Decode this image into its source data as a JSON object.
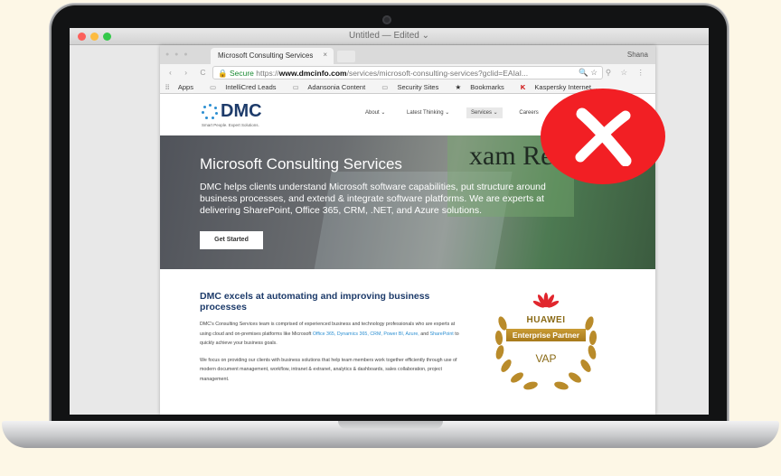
{
  "window": {
    "title": "Untitled — Edited ⌄"
  },
  "browser": {
    "tab_title": "Microsoft Consulting Services",
    "tab_close": "×",
    "profile": "Shana",
    "nav_buttons": "‹ › C",
    "secure_label": "Secure",
    "url_scheme": "https://",
    "url_host": "www.dmcinfo.com",
    "url_path": "/services/microsoft-consulting-services?gclid=EAIaI...",
    "url_tools": "🔍 ☆",
    "ext_icons": "⚲ ☆ ⋮"
  },
  "bookmarks": [
    "Apps",
    "IntelliCred Leads",
    "Adansonia Content",
    "Security Sites",
    "Bookmarks",
    "Kaspersky Internet..."
  ],
  "site": {
    "logo_text": "DMC",
    "logo_tagline": "Smart People. Expert Solutions.",
    "menu": [
      "About ⌄",
      "Latest Thinking ⌄",
      "Services ⌄",
      "Careers"
    ],
    "hero_title": "Microsoft Consulting Services",
    "hero_text": "DMC helps clients understand Microsoft software capabilities, put structure around business processes, and extend & integrate software platforms. We are experts at delivering SharePoint, Office 365, CRM, .NET, and Azure solutions.",
    "hero_book": "xam Ref",
    "cta": "Get Started",
    "section_title": "DMC excels at automating and improving business processes",
    "para1_a": "DMC's Consulting Services team is comprised of experienced business and technology professionals who are experts at using cloud and on-premises platforms like Microsoft ",
    "para1_links": "Office 365, Dynamics 365, CRM, Power BI, Azure,",
    "para1_b": " and ",
    "para1_link2": "SharePoint",
    "para1_c": " to quickly achieve your business goals.",
    "para2": "We focus on providing our clients with business solutions that help team members work together efficiently through use of modern document management, workflow, intranet & extranet, analytics & dashboards, sales collaboration, project management."
  },
  "overlays": {
    "x_badge_icon": "close-x-icon",
    "huawei_name": "HUAWEI",
    "huawei_partner": "Enterprise Partner",
    "huawei_level": "VAP"
  },
  "colors": {
    "red_badge": "#f21f24",
    "dmc_blue": "#1d3b6a",
    "link": "#2c8fd2",
    "gold": "#a77a1c"
  }
}
